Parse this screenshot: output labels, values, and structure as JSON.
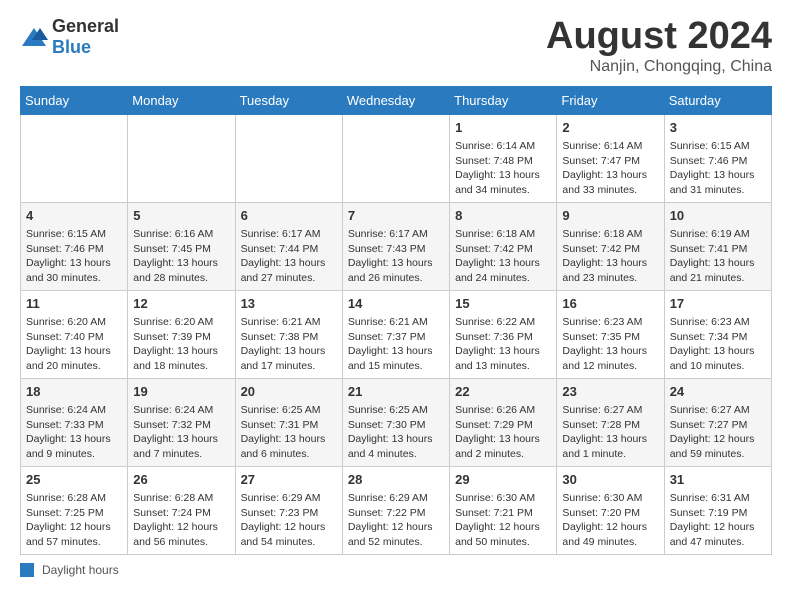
{
  "header": {
    "logo_general": "General",
    "logo_blue": "Blue",
    "month_year": "August 2024",
    "location": "Nanjin, Chongqing, China"
  },
  "days_of_week": [
    "Sunday",
    "Monday",
    "Tuesday",
    "Wednesday",
    "Thursday",
    "Friday",
    "Saturday"
  ],
  "weeks": [
    [
      {
        "day": "",
        "info": ""
      },
      {
        "day": "",
        "info": ""
      },
      {
        "day": "",
        "info": ""
      },
      {
        "day": "",
        "info": ""
      },
      {
        "day": "1",
        "info": "Sunrise: 6:14 AM\nSunset: 7:48 PM\nDaylight: 13 hours\nand 34 minutes."
      },
      {
        "day": "2",
        "info": "Sunrise: 6:14 AM\nSunset: 7:47 PM\nDaylight: 13 hours\nand 33 minutes."
      },
      {
        "day": "3",
        "info": "Sunrise: 6:15 AM\nSunset: 7:46 PM\nDaylight: 13 hours\nand 31 minutes."
      }
    ],
    [
      {
        "day": "4",
        "info": "Sunrise: 6:15 AM\nSunset: 7:46 PM\nDaylight: 13 hours\nand 30 minutes."
      },
      {
        "day": "5",
        "info": "Sunrise: 6:16 AM\nSunset: 7:45 PM\nDaylight: 13 hours\nand 28 minutes."
      },
      {
        "day": "6",
        "info": "Sunrise: 6:17 AM\nSunset: 7:44 PM\nDaylight: 13 hours\nand 27 minutes."
      },
      {
        "day": "7",
        "info": "Sunrise: 6:17 AM\nSunset: 7:43 PM\nDaylight: 13 hours\nand 26 minutes."
      },
      {
        "day": "8",
        "info": "Sunrise: 6:18 AM\nSunset: 7:42 PM\nDaylight: 13 hours\nand 24 minutes."
      },
      {
        "day": "9",
        "info": "Sunrise: 6:18 AM\nSunset: 7:42 PM\nDaylight: 13 hours\nand 23 minutes."
      },
      {
        "day": "10",
        "info": "Sunrise: 6:19 AM\nSunset: 7:41 PM\nDaylight: 13 hours\nand 21 minutes."
      }
    ],
    [
      {
        "day": "11",
        "info": "Sunrise: 6:20 AM\nSunset: 7:40 PM\nDaylight: 13 hours\nand 20 minutes."
      },
      {
        "day": "12",
        "info": "Sunrise: 6:20 AM\nSunset: 7:39 PM\nDaylight: 13 hours\nand 18 minutes."
      },
      {
        "day": "13",
        "info": "Sunrise: 6:21 AM\nSunset: 7:38 PM\nDaylight: 13 hours\nand 17 minutes."
      },
      {
        "day": "14",
        "info": "Sunrise: 6:21 AM\nSunset: 7:37 PM\nDaylight: 13 hours\nand 15 minutes."
      },
      {
        "day": "15",
        "info": "Sunrise: 6:22 AM\nSunset: 7:36 PM\nDaylight: 13 hours\nand 13 minutes."
      },
      {
        "day": "16",
        "info": "Sunrise: 6:23 AM\nSunset: 7:35 PM\nDaylight: 13 hours\nand 12 minutes."
      },
      {
        "day": "17",
        "info": "Sunrise: 6:23 AM\nSunset: 7:34 PM\nDaylight: 13 hours\nand 10 minutes."
      }
    ],
    [
      {
        "day": "18",
        "info": "Sunrise: 6:24 AM\nSunset: 7:33 PM\nDaylight: 13 hours\nand 9 minutes."
      },
      {
        "day": "19",
        "info": "Sunrise: 6:24 AM\nSunset: 7:32 PM\nDaylight: 13 hours\nand 7 minutes."
      },
      {
        "day": "20",
        "info": "Sunrise: 6:25 AM\nSunset: 7:31 PM\nDaylight: 13 hours\nand 6 minutes."
      },
      {
        "day": "21",
        "info": "Sunrise: 6:25 AM\nSunset: 7:30 PM\nDaylight: 13 hours\nand 4 minutes."
      },
      {
        "day": "22",
        "info": "Sunrise: 6:26 AM\nSunset: 7:29 PM\nDaylight: 13 hours\nand 2 minutes."
      },
      {
        "day": "23",
        "info": "Sunrise: 6:27 AM\nSunset: 7:28 PM\nDaylight: 13 hours\nand 1 minute."
      },
      {
        "day": "24",
        "info": "Sunrise: 6:27 AM\nSunset: 7:27 PM\nDaylight: 12 hours\nand 59 minutes."
      }
    ],
    [
      {
        "day": "25",
        "info": "Sunrise: 6:28 AM\nSunset: 7:25 PM\nDaylight: 12 hours\nand 57 minutes."
      },
      {
        "day": "26",
        "info": "Sunrise: 6:28 AM\nSunset: 7:24 PM\nDaylight: 12 hours\nand 56 minutes."
      },
      {
        "day": "27",
        "info": "Sunrise: 6:29 AM\nSunset: 7:23 PM\nDaylight: 12 hours\nand 54 minutes."
      },
      {
        "day": "28",
        "info": "Sunrise: 6:29 AM\nSunset: 7:22 PM\nDaylight: 12 hours\nand 52 minutes."
      },
      {
        "day": "29",
        "info": "Sunrise: 6:30 AM\nSunset: 7:21 PM\nDaylight: 12 hours\nand 50 minutes."
      },
      {
        "day": "30",
        "info": "Sunrise: 6:30 AM\nSunset: 7:20 PM\nDaylight: 12 hours\nand 49 minutes."
      },
      {
        "day": "31",
        "info": "Sunrise: 6:31 AM\nSunset: 7:19 PM\nDaylight: 12 hours\nand 47 minutes."
      }
    ]
  ],
  "legend": {
    "label": "Daylight hours"
  }
}
